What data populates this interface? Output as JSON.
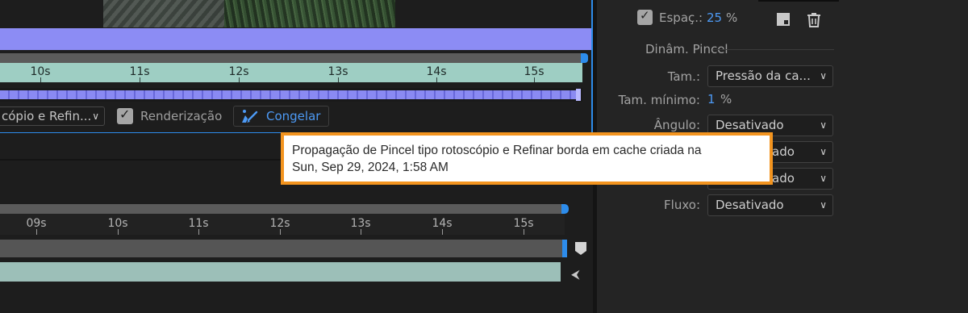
{
  "timeline_top": {
    "ticks": [
      "10s",
      "11s",
      "12s",
      "13s",
      "14s",
      "15s"
    ]
  },
  "toolbar": {
    "propagation_select_value": "cópio e Refin...",
    "render_label": "Renderização",
    "render_checked": true,
    "freeze_button_label": "Congelar",
    "freeze_icon": "brush-snowflake-icon"
  },
  "tooltip": {
    "line1": "Propagação de Pincel tipo rotoscópio e Refinar borda em cache criada na",
    "line2": "Sun, Sep 29, 2024, 1:58 AM"
  },
  "timeline_bottom": {
    "ticks": [
      "09s",
      "10s",
      "11s",
      "12s",
      "13s",
      "14s",
      "15s"
    ]
  },
  "brush_panel": {
    "spacing_label": "Espaç.:",
    "spacing_value": "25",
    "spacing_unit": "%",
    "spacing_checked": true,
    "dynamics_title": "Dinâm. Pincel",
    "size_label": "Tam.:",
    "size_value": "Pressão da ca...",
    "min_size_label": "Tam. mínimo:",
    "min_size_value": "1",
    "min_size_unit": "%",
    "angle_label": "Ângulo:",
    "angle_value": "Desativado",
    "row4_value": "ado",
    "row5_value": "ado",
    "flow_label": "Fluxo:",
    "flow_value": "Desativado"
  },
  "colors": {
    "accent_blue": "#2d8ceb",
    "tooltip_highlight": "#f3941f",
    "layer_purple": "#8c8cf4",
    "layer_teal": "#9ecec3"
  }
}
